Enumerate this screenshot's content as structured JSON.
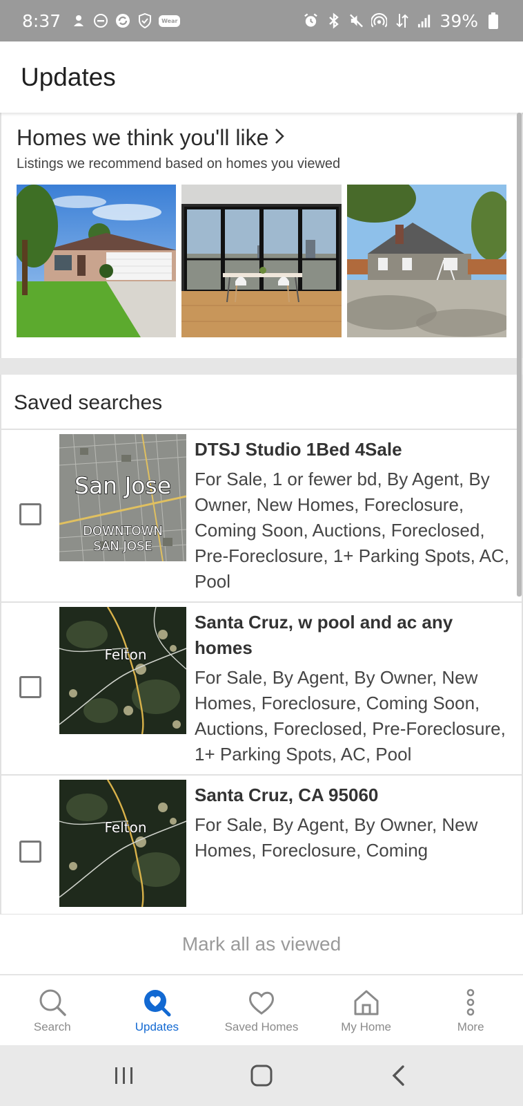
{
  "status_bar": {
    "time": "8:37",
    "battery": "39%",
    "wear_badge": "Wear",
    "left_icons": [
      "app-notification-icon",
      "dnd-icon",
      "sync-icon",
      "shield-icon",
      "wear-icon"
    ],
    "right_icons": [
      "alarm-icon",
      "bluetooth-icon",
      "mute-icon",
      "hotspot-icon",
      "data-icon",
      "signal-icon",
      "battery-icon"
    ]
  },
  "header": {
    "title": "Updates"
  },
  "recommendations": {
    "title": "Homes we think you'll like",
    "chevron": "›",
    "subtitle": "Listings we recommend based on homes you viewed",
    "photos": [
      "suburban-house-photo",
      "apartment-window-photo",
      "bungalow-photo"
    ]
  },
  "saved_searches": {
    "title": "Saved searches",
    "items": [
      {
        "title": "DTSJ Studio 1Bed 4Sale",
        "description": "For Sale, 1 or fewer bd, By Agent, By Owner, New Homes, Foreclosure, Coming Soon, Auctions, Foreclosed, Pre-Foreclosure, 1+ Parking Spots, AC, Pool",
        "map_label_1": "San Jose",
        "map_label_2": "DOWNTOWN",
        "map_label_3": "SAN JOSE"
      },
      {
        "title": "Santa Cruz, w pool and ac any homes",
        "description": "For Sale, By Agent, By Owner, New Homes, Foreclosure, Coming Soon, Auctions, Foreclosed, Pre-Foreclosure, 1+ Parking Spots, AC, Pool",
        "map_label": "Felton"
      },
      {
        "title": "Santa Cruz, CA 95060",
        "description": "For Sale, By Agent, By Owner, New Homes, Foreclosure, Coming",
        "map_label": "Felton"
      }
    ]
  },
  "mark_all": "Mark all as viewed",
  "bottom_nav": {
    "items": [
      {
        "label": "Search",
        "icon": "search-icon",
        "active": false
      },
      {
        "label": "Updates",
        "icon": "updates-heart-icon",
        "active": true
      },
      {
        "label": "Saved Homes",
        "icon": "heart-icon",
        "active": false
      },
      {
        "label": "My Home",
        "icon": "house-icon",
        "active": false
      },
      {
        "label": "More",
        "icon": "more-vertical-icon",
        "active": false
      }
    ]
  },
  "colors": {
    "accent": "#1269d2",
    "status_bar": "#9a9a9a",
    "nav_inactive": "#8a8a8a"
  }
}
